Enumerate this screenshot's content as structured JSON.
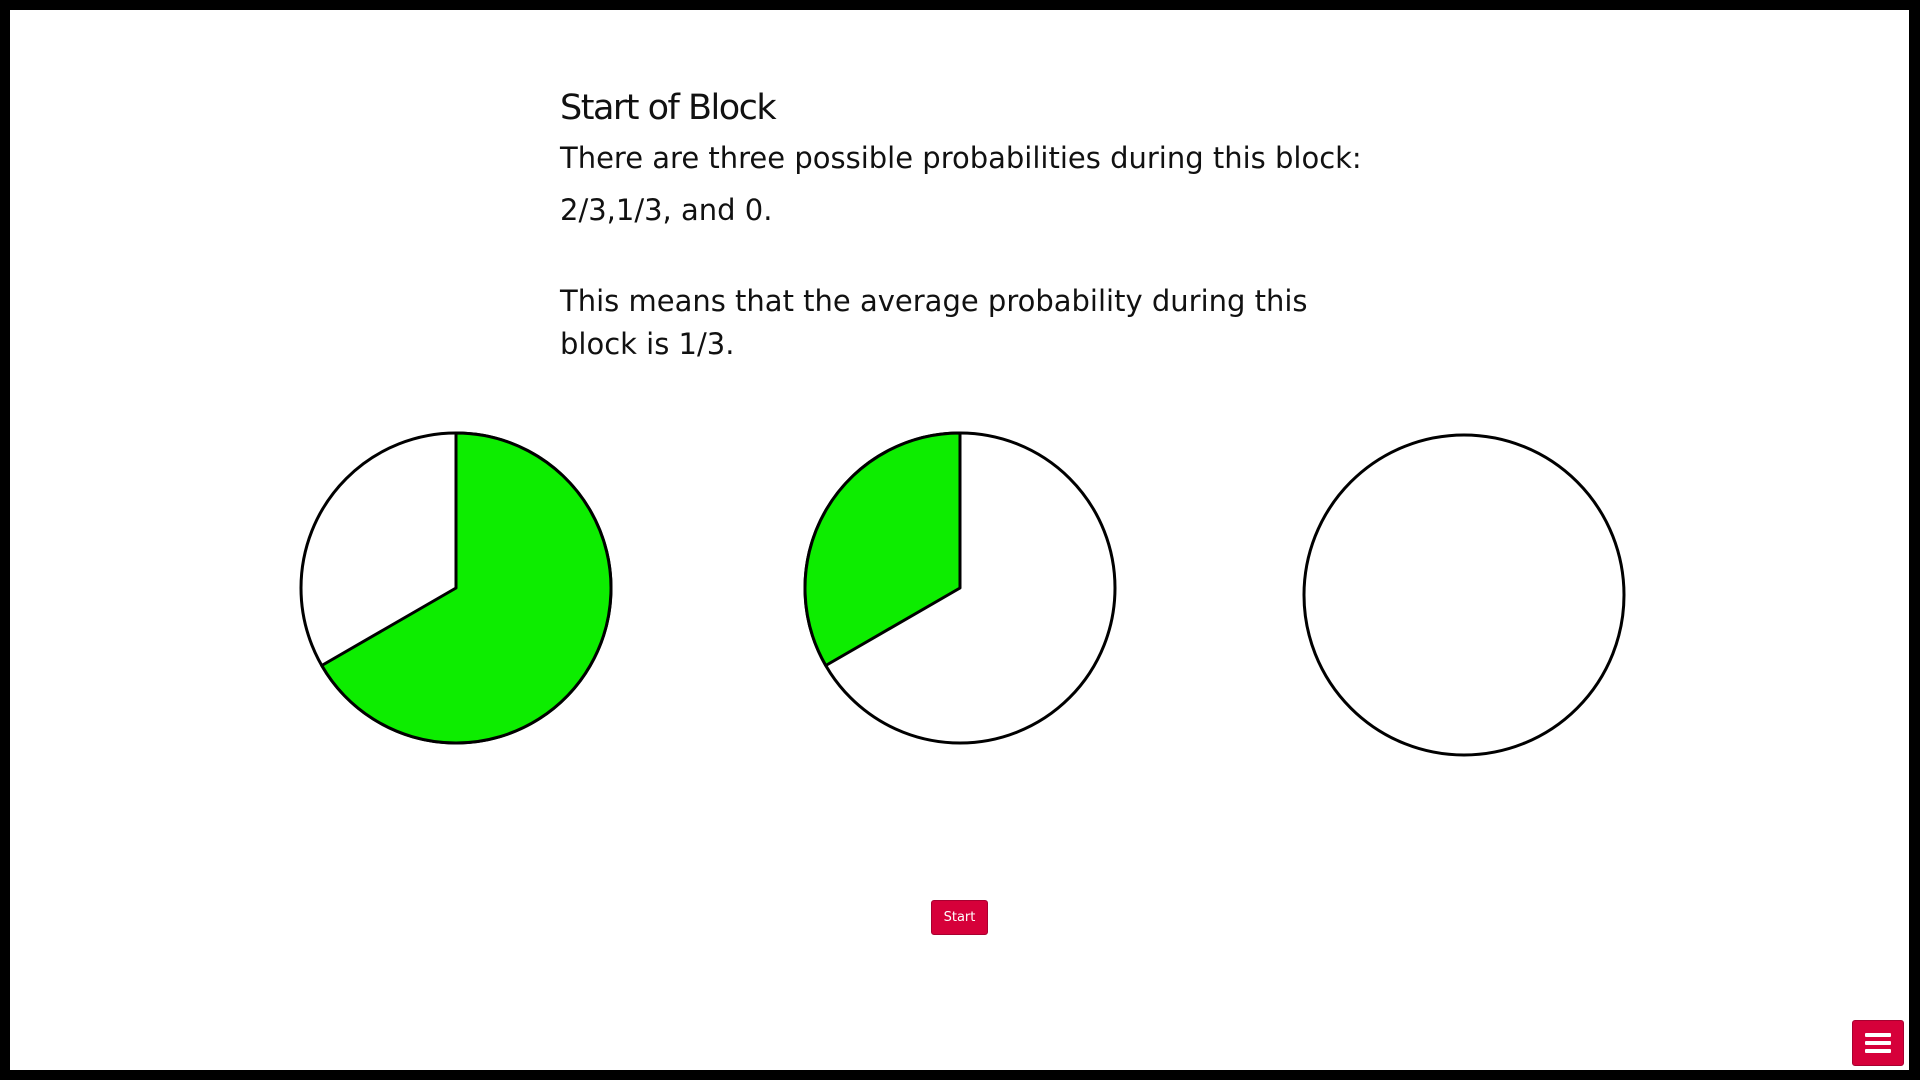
{
  "instructions": {
    "title": "Start of Block",
    "line1": "There are three possible probabilities during this block:",
    "line2": "2/3,1/3, and 0.",
    "para2": "This means that the average probability during this block is 1/3."
  },
  "chart_data": [
    {
      "type": "pie",
      "values": [
        2,
        1
      ],
      "labels": [
        "green",
        "white"
      ],
      "green_fraction": 0.6667
    },
    {
      "type": "pie",
      "values": [
        1,
        2
      ],
      "labels": [
        "green",
        "white"
      ],
      "green_fraction": 0.3333
    },
    {
      "type": "pie",
      "values": [
        0,
        1
      ],
      "labels": [
        "green",
        "white"
      ],
      "green_fraction": 0
    }
  ],
  "colors": {
    "fill": "#0ded00",
    "empty": "#ffffff",
    "stroke": "#000000",
    "accent": "#d6003a"
  },
  "buttons": {
    "start_label": "Start",
    "menu_icon": "hamburger-menu-icon"
  }
}
